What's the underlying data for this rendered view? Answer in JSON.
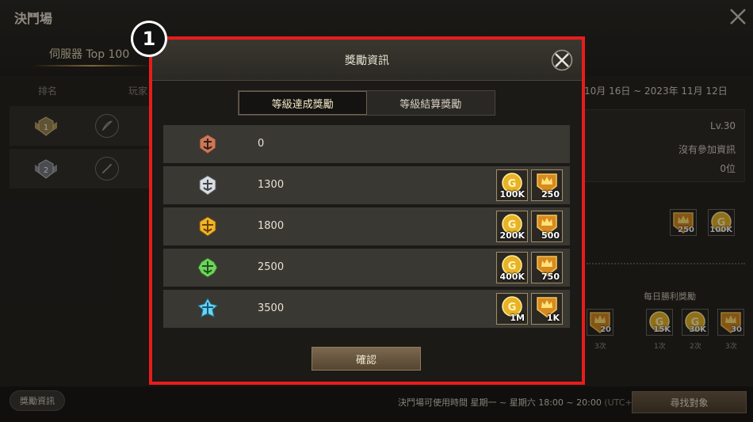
{
  "background": {
    "window_title": "決鬥場",
    "tab_label": "伺服器 Top 100",
    "columns": [
      "排名",
      "玩家"
    ],
    "date_range": "10月 16日 ~ 2023年 11月 12日",
    "level": "Lv.30",
    "participation": "沒有參加資訊",
    "rank": "0位",
    "reward_items": [
      {
        "type": "crown",
        "label": "250"
      },
      {
        "type": "gold",
        "label": "100K"
      }
    ],
    "daily_title": "每日勝利獎勵",
    "daily_items": [
      {
        "type": "crown",
        "label": "20",
        "count": "3次"
      },
      {
        "type": "gold",
        "label": "15K",
        "count": "1次"
      },
      {
        "type": "gold",
        "label": "30K",
        "count": "2次"
      },
      {
        "type": "crown",
        "label": "30",
        "count": "3次"
      }
    ],
    "reward_info_button": "獎勵資訊",
    "schedule_text": "決鬥場可使用時間 星期一 ~ 星期六 18:00 ~ 20:00",
    "schedule_tz": "(UTC+8)",
    "find_button": "尋找對象"
  },
  "annotation": {
    "marker": "1"
  },
  "modal": {
    "title": "獎勵資訊",
    "tabs": [
      {
        "label": "等級達成獎勵",
        "active": true
      },
      {
        "label": "等級結算獎勵",
        "active": false
      }
    ],
    "rows": [
      {
        "tier": "bronze",
        "tier_color": "#c9785a",
        "score": "0",
        "gold": "",
        "crown": ""
      },
      {
        "tier": "silver",
        "tier_color": "#d9dde2",
        "score": "1300",
        "gold": "100K",
        "crown": "250"
      },
      {
        "tier": "gold",
        "tier_color": "#f1b52a",
        "score": "1800",
        "gold": "200K",
        "crown": "500"
      },
      {
        "tier": "emerald",
        "tier_color": "#6fd35c",
        "score": "2500",
        "gold": "400K",
        "crown": "750"
      },
      {
        "tier": "diamond",
        "tier_color": "#6ad4f2",
        "score": "3500",
        "gold": "1M",
        "crown": "1K"
      }
    ],
    "confirm_label": "確認"
  }
}
